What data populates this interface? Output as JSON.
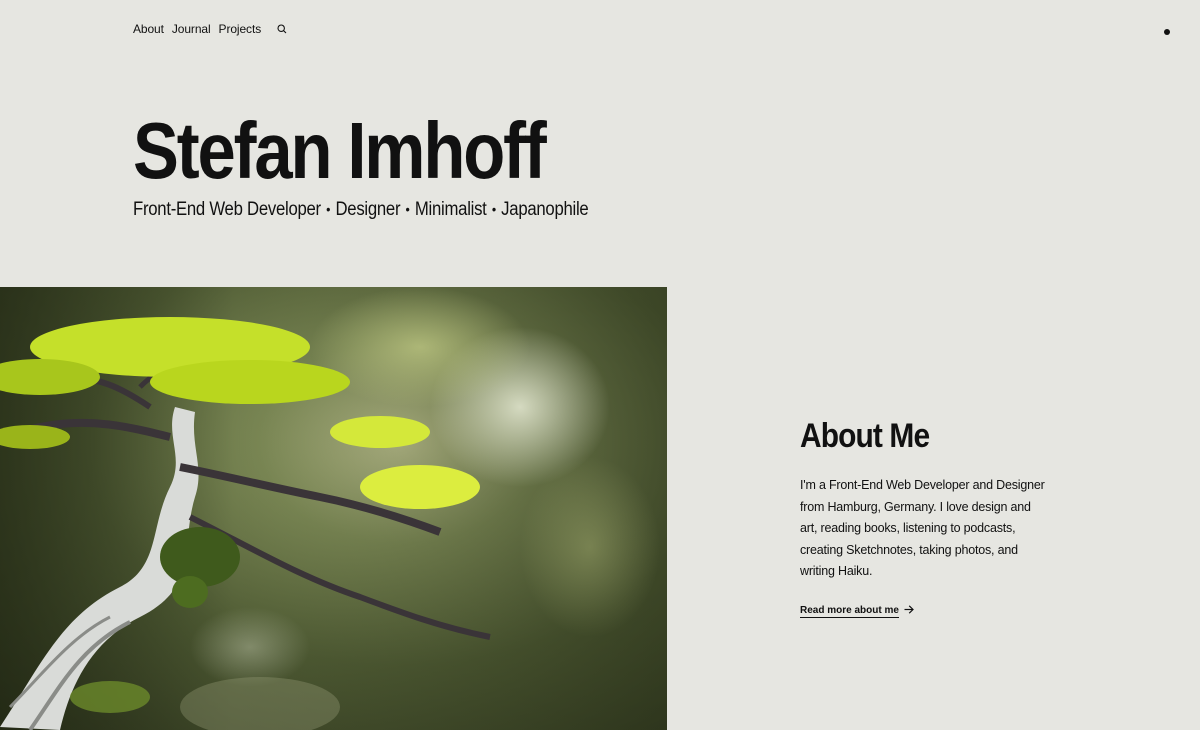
{
  "nav": {
    "items": [
      {
        "label": "About"
      },
      {
        "label": "Journal"
      },
      {
        "label": "Projects"
      }
    ],
    "search_icon": "search-icon",
    "menu_icon": "menu-dot-icon"
  },
  "hero": {
    "title": "Stefan Imhoff",
    "roles": [
      "Front-End Web Developer",
      "Designer",
      "Minimalist",
      "Japanophile"
    ],
    "separator": "•"
  },
  "image": {
    "subject": "bonsai-tree-photo"
  },
  "about": {
    "heading": "About Me",
    "body": "I'm a Front-End Web Developer and Designer from Hamburg, Germany. I love design and art, reading books, listening to podcasts, creating Sketchnotes, taking photos, and writing Haiku.",
    "link_label": "Read more about me",
    "link_icon": "arrow-right-icon"
  },
  "colors": {
    "background": "#e6e6e1",
    "text": "#111111"
  }
}
